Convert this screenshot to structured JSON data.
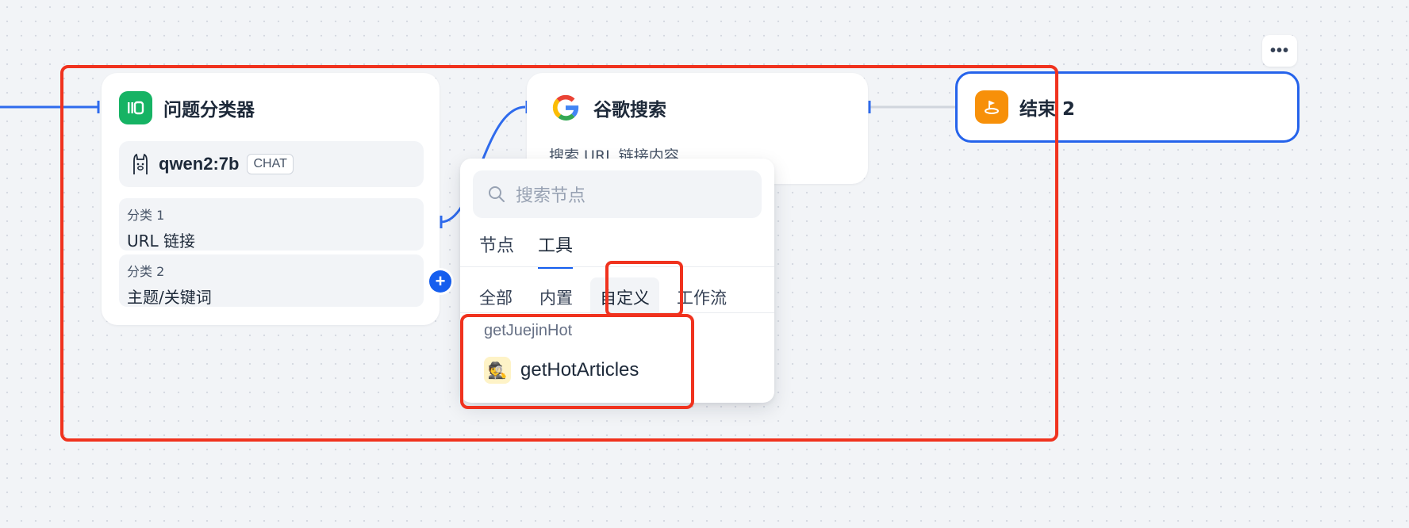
{
  "canvas": {
    "background": "#f2f4f7",
    "edge_color": "#2f6bed"
  },
  "classifier_node": {
    "title": "问题分类器",
    "icon": "classifier-icon",
    "icon_color": "#16b364",
    "model": {
      "icon": "llama-icon",
      "name": "qwen2:7b",
      "badge": "CHAT"
    },
    "classes": [
      {
        "label": "分类 1",
        "value": "URL 链接"
      },
      {
        "label": "分类 2",
        "value": "主题/关键词"
      }
    ]
  },
  "google_node": {
    "title": "谷歌搜索",
    "icon": "google-icon",
    "description": "搜索 URL 链接内容"
  },
  "end_node": {
    "title": "结束 2",
    "icon": "end-icon",
    "icon_color": "#f79009",
    "border_color": "#2563eb"
  },
  "more_button": {
    "label": "•••"
  },
  "add_button": {
    "label": "+"
  },
  "node_picker": {
    "search_placeholder": "搜索节点",
    "tabs": [
      {
        "label": "节点",
        "active": false
      },
      {
        "label": "工具",
        "active": true
      }
    ],
    "subtabs": [
      {
        "label": "全部",
        "active": false
      },
      {
        "label": "内置",
        "active": false
      },
      {
        "label": "自定义",
        "active": true
      },
      {
        "label": "工作流",
        "active": false
      }
    ],
    "groups": [
      {
        "label": "getJuejinHot",
        "items": [
          {
            "label": "getHotArticles",
            "icon": "detective-emoji-icon",
            "emoji": "🕵️"
          }
        ]
      }
    ]
  },
  "highlight_color": "#f0321e"
}
